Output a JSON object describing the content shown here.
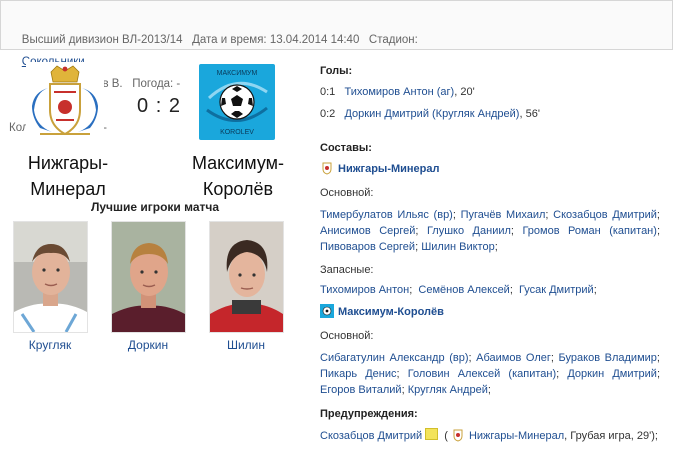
{
  "match_info": {
    "line1_prefix": "Высший дивизион ВЛ-2013/14   Дата и время: 13.04.2014 14:40   Стадион:",
    "stadium": "Сокольники",
    "line1_suffix": "   Судья: Волков В.   Погода: -",
    "line2": "Кол-во зрителей: -"
  },
  "home_team": {
    "name_line1": "Нижгары-",
    "name_line2": "Минерал"
  },
  "away_team": {
    "name_line1": "Максимум-",
    "name_line2": "Королёв",
    "logo_top_text": "МАКСИМУМ",
    "logo_bottom_text": "KOROLEV"
  },
  "score": "0 : 2",
  "best_players": {
    "title": "Лучшие игроки матча",
    "players": [
      {
        "name": "Кругляк",
        "shirt_color": "#ffffff"
      },
      {
        "name": "Доркин",
        "shirt_color": "#5a1e2c"
      },
      {
        "name": "Шилин",
        "shirt_color": "#c5262b"
      }
    ]
  },
  "goals": {
    "title": "Голы:",
    "items": [
      {
        "score": "0:1",
        "scorer": "Тихомиров Антон (аг)",
        "minute": ", 20'"
      },
      {
        "score": "0:2",
        "scorer": "Доркин Дмитрий (Кругляк Андрей)",
        "minute": ", 56'"
      }
    ]
  },
  "lineups": {
    "title": "Составы:",
    "home": {
      "team": "Нижгары-Минерал",
      "main_label": "Основной:",
      "main": [
        "Тимербулатов Ильяс (вр)",
        "Пугачёв Михаил",
        "Скозабцов Дмитрий",
        "Анисимов Сергей",
        "Глушко Даниил",
        "Громов Роман (капитан)",
        "Пивоваров Сергей",
        "Шилин Виктор"
      ],
      "subs_label": "Запасные:",
      "subs": [
        "Тихомиров Антон",
        "Семёнов Алексей",
        "Гусак Дмитрий"
      ]
    },
    "away": {
      "team": "Максимум-Королёв",
      "main_label": "Основной:",
      "main": [
        "Сибагатулин Александр (вр)",
        "Абаимов Олег",
        "Бураков Владимир",
        "Пикарь Денис",
        "Головин Алексей (капитан)",
        "Доркин Дмитрий",
        "Егоров Виталий",
        "Кругляк Андрей"
      ]
    }
  },
  "warnings": {
    "title": "Предупреждения:",
    "items": [
      {
        "player": "Скозабцов Дмитрий",
        "team": "Нижгары-Минерал",
        "detail": ", Грубая игра, 29');",
        "open_paren": "("
      }
    ]
  },
  "colors": {
    "link": "#1f4e91",
    "card_yellow": "#f3e35a",
    "away_logo_bg": "#1aa7dc"
  },
  "icons": {
    "home_logo": "coat-of-arms",
    "away_logo": "soccer-ball",
    "warning": "yellow-card"
  }
}
